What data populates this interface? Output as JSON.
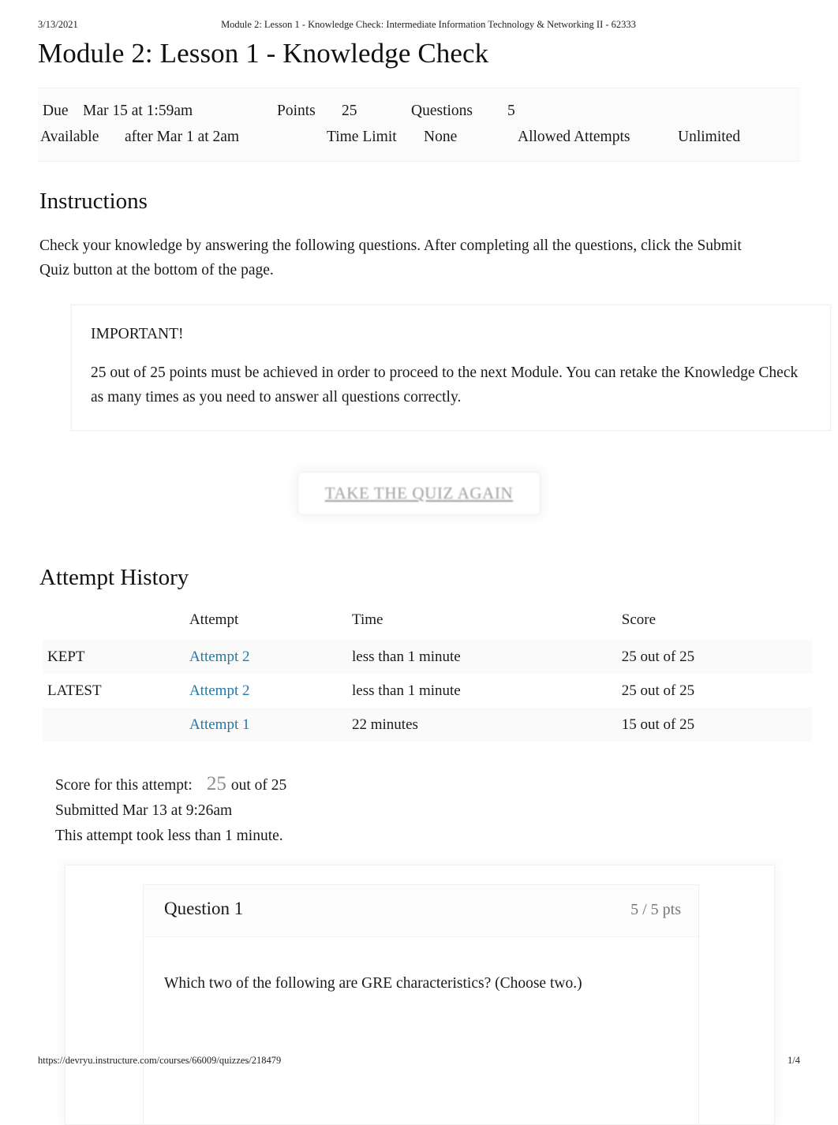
{
  "print": {
    "date": "3/13/2021",
    "doc_title": "Module 2: Lesson 1 - Knowledge Check: Intermediate Information Technology & Networking II - 62333",
    "footer_url": "https://devryu.instructure.com/courses/66009/quizzes/218479",
    "page_number": "1/4"
  },
  "quiz": {
    "title": "Module 2: Lesson 1 - Knowledge Check",
    "info": {
      "due_label": "Due",
      "due_value": "Mar 15 at 1:59am",
      "points_label": "Points",
      "points_value": "25",
      "questions_label": "Questions",
      "questions_value": "5",
      "available_label": "Available",
      "available_value": "after Mar 1 at 2am",
      "time_limit_label": "Time Limit",
      "time_limit_value": "None",
      "attempts_label": "Allowed Attempts",
      "attempts_value": "Unlimited"
    }
  },
  "instructions": {
    "heading": "Instructions",
    "body": "Check your knowledge by answering the following questions. After completing all the questions, click the Submit Quiz button at the bottom of the page.",
    "important": {
      "title": "IMPORTANT!",
      "body": "25 out of 25 points must be achieved in order to proceed to the next Module. You can retake the Knowledge Check as many times as you need to answer all questions correctly."
    }
  },
  "actions": {
    "take_again_label": "TAKE THE QUIZ AGAIN"
  },
  "attempt_history": {
    "heading": "Attempt History",
    "columns": [
      "",
      "Attempt",
      "Time",
      "Score"
    ],
    "rows": [
      {
        "status": "KEPT",
        "attempt": "Attempt 2",
        "time": "less than 1 minute",
        "score": "25 out of 25"
      },
      {
        "status": "LATEST",
        "attempt": "Attempt 2",
        "time": "less than 1 minute",
        "score": "25 out of 25"
      },
      {
        "status": "",
        "attempt": "Attempt 1",
        "time": "22 minutes",
        "score": "15 out of 25"
      }
    ]
  },
  "score_summary": {
    "score_label": "Score for this attempt:",
    "score_value": "25",
    "score_out_of": "out of 25",
    "submitted": "Submitted Mar 13 at 9:26am",
    "duration": "This attempt took less than 1 minute."
  },
  "question": {
    "name": "Question 1",
    "points": "5 / 5 pts",
    "text": "Which two of the following are GRE characteristics? (Choose two.)"
  },
  "colors": {
    "link": "#2079a9",
    "muted_text": "#777777",
    "band_bg": "#fbfbfb",
    "page_bg": "#ffffff"
  }
}
